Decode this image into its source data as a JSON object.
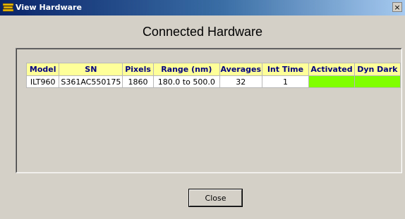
{
  "window": {
    "title": "View Hardware",
    "close_glyph": "×"
  },
  "heading": "Connected Hardware",
  "table": {
    "headers": [
      "Model",
      "SN",
      "Pixels",
      "Range (nm)",
      "Averages",
      "Int Time",
      "Activated",
      "Dyn Dark"
    ],
    "rows": [
      {
        "model": "ILT960",
        "sn": "S361AC550175",
        "pixels": "1860",
        "range": "180.0 to 500.0",
        "averages": "32",
        "int_time": "1",
        "activated_color": "#80ff00",
        "dyn_dark_color": "#80ff00"
      }
    ]
  },
  "buttons": {
    "close_label": "Close"
  },
  "colors": {
    "header_bg": "#ffff99",
    "header_text": "#000080",
    "status_on": "#80ff00",
    "titlebar_start": "#0a246a"
  },
  "icons": {
    "app": "hardware-icon"
  }
}
